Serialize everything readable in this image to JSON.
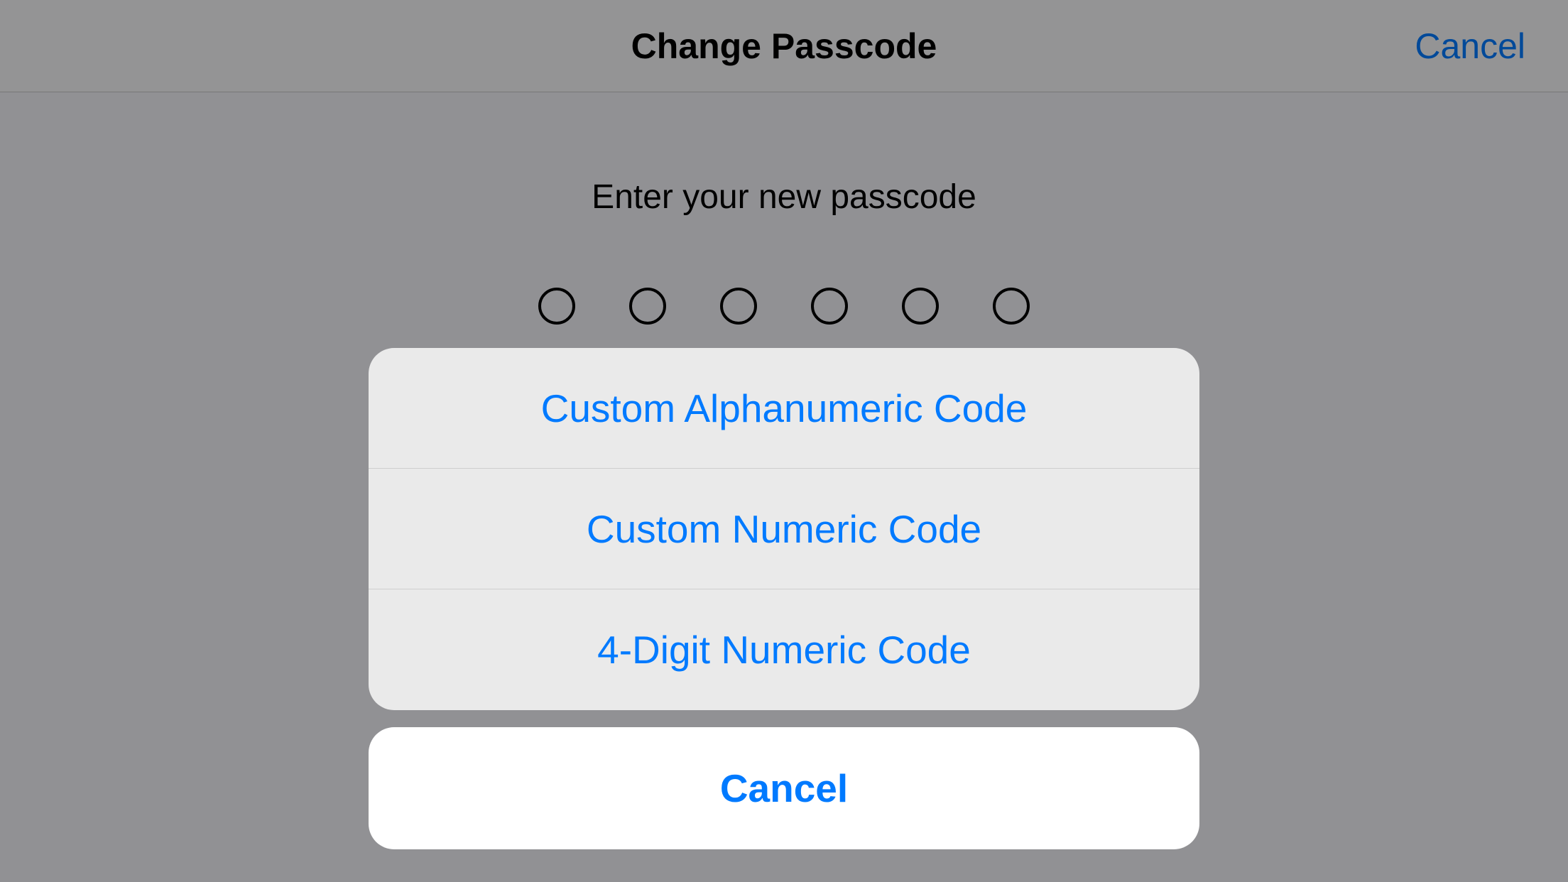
{
  "nav": {
    "title": "Change Passcode",
    "cancel": "Cancel"
  },
  "prompt": "Enter your new passcode",
  "passcode": {
    "length": 6
  },
  "action_sheet": {
    "options": [
      "Custom Alphanumeric Code",
      "Custom Numeric Code",
      "4-Digit Numeric Code"
    ],
    "cancel": "Cancel"
  }
}
